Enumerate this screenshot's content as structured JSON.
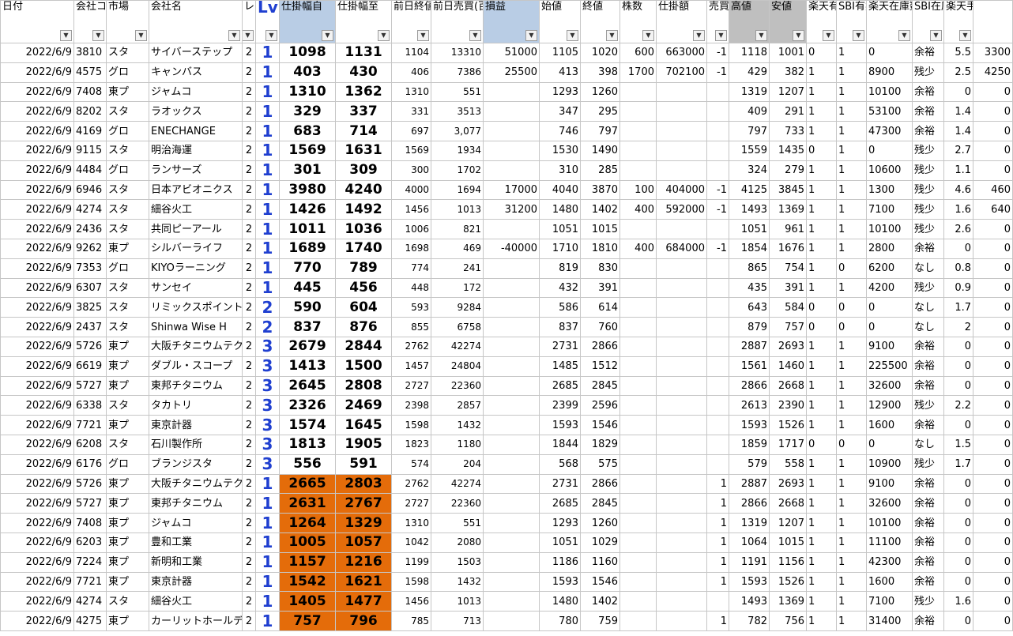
{
  "columns": [
    {
      "label": "日付",
      "style": ""
    },
    {
      "label": "会社コード",
      "style": ""
    },
    {
      "label": "市場",
      "style": ""
    },
    {
      "label": "会社名",
      "style": ""
    },
    {
      "label": "レ",
      "style": ""
    },
    {
      "label": "Lv",
      "style": "lv"
    },
    {
      "label": "仕掛幅自",
      "style": "blue"
    },
    {
      "label": "仕掛幅至",
      "style": ""
    },
    {
      "label": "前日終値",
      "style": ""
    },
    {
      "label": "前日売買(百万円)",
      "style": ""
    },
    {
      "label": "損益",
      "style": "blue"
    },
    {
      "label": "始値",
      "style": ""
    },
    {
      "label": "終値",
      "style": ""
    },
    {
      "label": "株数",
      "style": ""
    },
    {
      "label": "仕掛額",
      "style": ""
    },
    {
      "label": "売買",
      "style": ""
    },
    {
      "label": "高値",
      "style": "gray"
    },
    {
      "label": "安値",
      "style": "gray"
    },
    {
      "label": "楽天有無",
      "style": ""
    },
    {
      "label": "SBI有無",
      "style": ""
    },
    {
      "label": "楽天在庫数",
      "style": ""
    },
    {
      "label": "SBI在庫数",
      "style": ""
    },
    {
      "label": "楽天手数料",
      "style": ""
    },
    {
      "label": "",
      "style": ""
    }
  ],
  "rows": [
    [
      "2022/6/9",
      "3810",
      "スタ",
      "サイバーステップ",
      "2",
      "1",
      "1098",
      "1131",
      "1104",
      "13310",
      "51000",
      "1105",
      "1020",
      "600",
      "663000",
      "-1",
      "1118",
      "1001",
      "0",
      "1",
      "0",
      "余裕",
      "5.5",
      "3300"
    ],
    [
      "2022/6/9",
      "4575",
      "グロ",
      "キャンバス",
      "2",
      "1",
      "403",
      "430",
      "406",
      "7386",
      "25500",
      "413",
      "398",
      "1700",
      "702100",
      "-1",
      "429",
      "382",
      "1",
      "1",
      "8900",
      "残少",
      "2.5",
      "4250"
    ],
    [
      "2022/6/9",
      "7408",
      "東プ",
      "ジャムコ",
      "2",
      "1",
      "1310",
      "1362",
      "1310",
      "551",
      "",
      "1293",
      "1260",
      "",
      "",
      "",
      "1319",
      "1207",
      "1",
      "1",
      "10100",
      "余裕",
      "0",
      "0"
    ],
    [
      "2022/6/9",
      "8202",
      "スタ",
      "ラオックス",
      "2",
      "1",
      "329",
      "337",
      "331",
      "3513",
      "",
      "347",
      "295",
      "",
      "",
      "",
      "409",
      "291",
      "1",
      "1",
      "53100",
      "余裕",
      "1.4",
      "0"
    ],
    [
      "2022/6/9",
      "4169",
      "グロ",
      "ENECHANGE",
      "2",
      "1",
      "683",
      "714",
      "697",
      "3,077",
      "",
      "746",
      "797",
      "",
      "",
      "",
      "797",
      "733",
      "1",
      "1",
      "47300",
      "余裕",
      "1.4",
      "0"
    ],
    [
      "2022/6/9",
      "9115",
      "スタ",
      "明治海運",
      "2",
      "1",
      "1569",
      "1631",
      "1569",
      "1934",
      "",
      "1530",
      "1490",
      "",
      "",
      "",
      "1559",
      "1435",
      "0",
      "1",
      "0",
      "残少",
      "2.7",
      "0"
    ],
    [
      "2022/6/9",
      "4484",
      "グロ",
      "ランサーズ",
      "2",
      "1",
      "301",
      "309",
      "300",
      "1702",
      "",
      "310",
      "285",
      "",
      "",
      "",
      "324",
      "279",
      "1",
      "1",
      "10600",
      "残少",
      "1.1",
      "0"
    ],
    [
      "2022/6/9",
      "6946",
      "スタ",
      "日本アビオニクス",
      "2",
      "1",
      "3980",
      "4240",
      "4000",
      "1694",
      "17000",
      "4040",
      "3870",
      "100",
      "404000",
      "-1",
      "4125",
      "3845",
      "1",
      "1",
      "1300",
      "残少",
      "4.6",
      "460"
    ],
    [
      "2022/6/9",
      "4274",
      "スタ",
      "細谷火工",
      "2",
      "1",
      "1426",
      "1492",
      "1456",
      "1013",
      "31200",
      "1480",
      "1402",
      "400",
      "592000",
      "-1",
      "1493",
      "1369",
      "1",
      "1",
      "7100",
      "残少",
      "1.6",
      "640"
    ],
    [
      "2022/6/9",
      "2436",
      "スタ",
      "共同ピーアール",
      "2",
      "1",
      "1011",
      "1036",
      "1006",
      "821",
      "",
      "1051",
      "1015",
      "",
      "",
      "",
      "1051",
      "961",
      "1",
      "1",
      "10100",
      "残少",
      "2.6",
      "0"
    ],
    [
      "2022/6/9",
      "9262",
      "東プ",
      "シルバーライフ",
      "2",
      "1",
      "1689",
      "1740",
      "1698",
      "469",
      "-40000",
      "1710",
      "1810",
      "400",
      "684000",
      "-1",
      "1854",
      "1676",
      "1",
      "1",
      "2800",
      "余裕",
      "0",
      "0"
    ],
    [
      "2022/6/9",
      "7353",
      "グロ",
      "KIYOラーニング",
      "2",
      "1",
      "770",
      "789",
      "774",
      "241",
      "",
      "819",
      "830",
      "",
      "",
      "",
      "865",
      "754",
      "1",
      "0",
      "6200",
      "なし",
      "0.8",
      "0"
    ],
    [
      "2022/6/9",
      "6307",
      "スタ",
      "サンセイ",
      "2",
      "1",
      "445",
      "456",
      "448",
      "172",
      "",
      "432",
      "391",
      "",
      "",
      "",
      "435",
      "391",
      "1",
      "1",
      "4200",
      "残少",
      "0.9",
      "0"
    ],
    [
      "2022/6/9",
      "3825",
      "スタ",
      "リミックスポイント",
      "2",
      "2",
      "590",
      "604",
      "593",
      "9284",
      "",
      "586",
      "614",
      "",
      "",
      "",
      "643",
      "584",
      "0",
      "0",
      "0",
      "なし",
      "1.7",
      "0"
    ],
    [
      "2022/6/9",
      "2437",
      "スタ",
      "Shinwa Wise H",
      "2",
      "2",
      "837",
      "876",
      "855",
      "6758",
      "",
      "837",
      "760",
      "",
      "",
      "",
      "879",
      "757",
      "0",
      "0",
      "0",
      "なし",
      "2",
      "0"
    ],
    [
      "2022/6/9",
      "5726",
      "東プ",
      "大阪チタニウムテク",
      "2",
      "3",
      "2679",
      "2844",
      "2762",
      "42274",
      "",
      "2731",
      "2866",
      "",
      "",
      "",
      "2887",
      "2693",
      "1",
      "1",
      "9100",
      "余裕",
      "0",
      "0"
    ],
    [
      "2022/6/9",
      "6619",
      "東プ",
      "ダブル・スコープ",
      "2",
      "3",
      "1413",
      "1500",
      "1457",
      "24804",
      "",
      "1485",
      "1512",
      "",
      "",
      "",
      "1561",
      "1460",
      "1",
      "1",
      "225500",
      "余裕",
      "0",
      "0"
    ],
    [
      "2022/6/9",
      "5727",
      "東プ",
      "東邦チタニウム",
      "2",
      "3",
      "2645",
      "2808",
      "2727",
      "22360",
      "",
      "2685",
      "2845",
      "",
      "",
      "",
      "2866",
      "2668",
      "1",
      "1",
      "32600",
      "余裕",
      "0",
      "0"
    ],
    [
      "2022/6/9",
      "6338",
      "スタ",
      "タカトリ",
      "2",
      "3",
      "2326",
      "2469",
      "2398",
      "2857",
      "",
      "2399",
      "2596",
      "",
      "",
      "",
      "2613",
      "2390",
      "1",
      "1",
      "12900",
      "残少",
      "2.2",
      "0"
    ],
    [
      "2022/6/9",
      "7721",
      "東プ",
      "東京計器",
      "2",
      "3",
      "1574",
      "1645",
      "1598",
      "1432",
      "",
      "1593",
      "1546",
      "",
      "",
      "",
      "1593",
      "1526",
      "1",
      "1",
      "1600",
      "余裕",
      "0",
      "0"
    ],
    [
      "2022/6/9",
      "6208",
      "スタ",
      "石川製作所",
      "2",
      "3",
      "1813",
      "1905",
      "1823",
      "1180",
      "",
      "1844",
      "1829",
      "",
      "",
      "",
      "1859",
      "1717",
      "0",
      "0",
      "0",
      "なし",
      "1.5",
      "0"
    ],
    [
      "2022/6/9",
      "6176",
      "グロ",
      "ブランジスタ",
      "2",
      "3",
      "556",
      "591",
      "574",
      "204",
      "",
      "568",
      "575",
      "",
      "",
      "",
      "579",
      "558",
      "1",
      "1",
      "10900",
      "残少",
      "1.7",
      "0"
    ],
    [
      "2022/6/9",
      "5726",
      "東プ",
      "大阪チタニウムテク",
      "2",
      "1",
      "2665",
      "2803",
      "2762",
      "42274",
      "",
      "2731",
      "2866",
      "",
      "",
      "1",
      "2887",
      "2693",
      "1",
      "1",
      "9100",
      "余裕",
      "0",
      "0"
    ],
    [
      "2022/6/9",
      "5727",
      "東プ",
      "東邦チタニウム",
      "2",
      "1",
      "2631",
      "2767",
      "2727",
      "22360",
      "",
      "2685",
      "2845",
      "",
      "",
      "1",
      "2866",
      "2668",
      "1",
      "1",
      "32600",
      "余裕",
      "0",
      "0"
    ],
    [
      "2022/6/9",
      "7408",
      "東プ",
      "ジャムコ",
      "2",
      "1",
      "1264",
      "1329",
      "1310",
      "551",
      "",
      "1293",
      "1260",
      "",
      "",
      "1",
      "1319",
      "1207",
      "1",
      "1",
      "10100",
      "余裕",
      "0",
      "0"
    ],
    [
      "2022/6/9",
      "6203",
      "東プ",
      "豊和工業",
      "2",
      "1",
      "1005",
      "1057",
      "1042",
      "2080",
      "",
      "1051",
      "1029",
      "",
      "",
      "1",
      "1064",
      "1015",
      "1",
      "1",
      "11100",
      "余裕",
      "0",
      "0"
    ],
    [
      "2022/6/9",
      "7224",
      "東プ",
      "新明和工業",
      "2",
      "1",
      "1157",
      "1216",
      "1199",
      "1503",
      "",
      "1186",
      "1160",
      "",
      "",
      "1",
      "1191",
      "1156",
      "1",
      "1",
      "42300",
      "余裕",
      "0",
      "0"
    ],
    [
      "2022/6/9",
      "7721",
      "東プ",
      "東京計器",
      "2",
      "1",
      "1542",
      "1621",
      "1598",
      "1432",
      "",
      "1593",
      "1546",
      "",
      "",
      "1",
      "1593",
      "1526",
      "1",
      "1",
      "1600",
      "余裕",
      "0",
      "0"
    ],
    [
      "2022/6/9",
      "4274",
      "スタ",
      "細谷火工",
      "2",
      "1",
      "1405",
      "1477",
      "1456",
      "1013",
      "",
      "1480",
      "1402",
      "",
      "",
      "",
      "1493",
      "1369",
      "1",
      "1",
      "7100",
      "残少",
      "1.6",
      "0"
    ],
    [
      "2022/6/9",
      "4275",
      "東プ",
      "カーリットホールデ",
      "2",
      "1",
      "757",
      "796",
      "785",
      "713",
      "",
      "780",
      "759",
      "",
      "",
      "1",
      "782",
      "756",
      "1",
      "1",
      "31400",
      "余裕",
      "0",
      "0"
    ]
  ],
  "orange_rows_from": 22,
  "filter_glyph": "▼",
  "colors": {
    "lv_blue": "#1f3fd0",
    "header_blue": "#b9cde5",
    "header_gray": "#bfbfbf",
    "highlight_orange": "#e46c0a",
    "grid": "#c6c6c6"
  }
}
